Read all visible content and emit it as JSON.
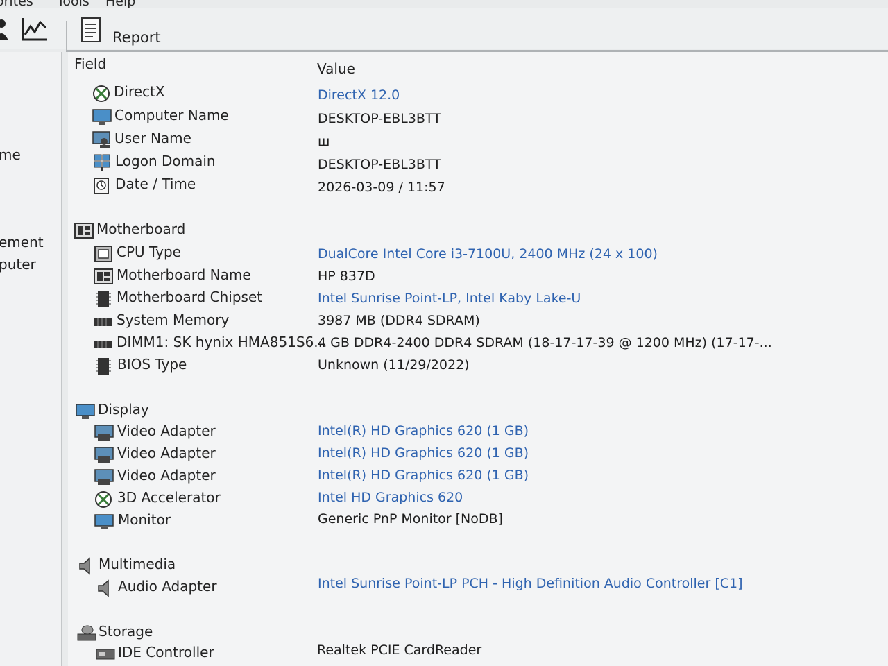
{
  "menu": [
    "orites",
    "Tools",
    "Help"
  ],
  "toolbar": {
    "report_label": "Report"
  },
  "left_pane": {
    "items": [
      "me",
      "ement",
      "puter"
    ]
  },
  "columns": {
    "field": "Field",
    "value": "Value"
  },
  "rows": [
    {
      "field": "DirectX",
      "value": "DirectX 12.0",
      "icon": "xbox-icon",
      "link": true
    },
    {
      "field": "Computer Name",
      "value": "DESKTOP-EBL3BTT",
      "icon": "computer-icon",
      "link": false
    },
    {
      "field": "User Name",
      "value": "ш",
      "icon": "user-icon",
      "link": false
    },
    {
      "field": "Logon Domain",
      "value": "DESKTOP-EBL3BTT",
      "icon": "network-icon",
      "link": false
    },
    {
      "field": "Date / Time",
      "value": "2026-03-09 / 11:57",
      "icon": "calendar-icon",
      "link": false
    },
    {
      "field": "Motherboard",
      "value": "",
      "icon": "motherboard-icon",
      "link": false
    },
    {
      "field": "CPU Type",
      "value": "DualCore Intel Core i3-7100U, 2400 MHz (24 x 100)",
      "icon": "cpu-icon",
      "link": true
    },
    {
      "field": "Motherboard Name",
      "value": "HP 837D",
      "icon": "motherboard-icon",
      "link": false
    },
    {
      "field": "Motherboard Chipset",
      "value": "Intel Sunrise Point-LP, Intel Kaby Lake-U",
      "icon": "chip-icon",
      "link": true
    },
    {
      "field": "System Memory",
      "value": "3987 MB  (DDR4 SDRAM)",
      "icon": "memory-icon",
      "link": false
    },
    {
      "field": "DIMM1: SK hynix HMA851S6...",
      "value": "4 GB DDR4-2400 DDR4 SDRAM  (18-17-17-39 @ 1200 MHz)  (17-17-...",
      "icon": "memory-icon",
      "link": false
    },
    {
      "field": "BIOS Type",
      "value": "Unknown (11/29/2022)",
      "icon": "chip-icon",
      "link": false
    },
    {
      "field": "Display",
      "value": "",
      "icon": "monitor-icon",
      "link": false
    },
    {
      "field": "Video Adapter",
      "value": "Intel(R) HD Graphics 620  (1 GB)",
      "icon": "video-adapter-icon",
      "link": true
    },
    {
      "field": "Video Adapter",
      "value": "Intel(R) HD Graphics 620  (1 GB)",
      "icon": "video-adapter-icon",
      "link": true
    },
    {
      "field": "Video Adapter",
      "value": "Intel(R) HD Graphics 620  (1 GB)",
      "icon": "video-adapter-icon",
      "link": true
    },
    {
      "field": "3D Accelerator",
      "value": "Intel HD Graphics 620",
      "icon": "xbox-icon",
      "link": true
    },
    {
      "field": "Monitor",
      "value": "Generic PnP Monitor [NoDB]",
      "icon": "monitor-icon",
      "link": false
    },
    {
      "field": "Multimedia",
      "value": "",
      "icon": "speaker-icon",
      "link": false
    },
    {
      "field": "Audio Adapter",
      "value": "Intel Sunrise Point-LP PCH - High Definition Audio Controller [C1]",
      "icon": "speaker-icon",
      "link": true
    },
    {
      "field": "Storage",
      "value": "",
      "icon": "storage-icon",
      "link": false
    },
    {
      "field": "IDE Controller",
      "value": "Realtek PCIE CardReader",
      "icon": "controller-icon",
      "link": false
    }
  ],
  "colors": {
    "link": "#2f63b0",
    "text": "#1e1e1e"
  }
}
